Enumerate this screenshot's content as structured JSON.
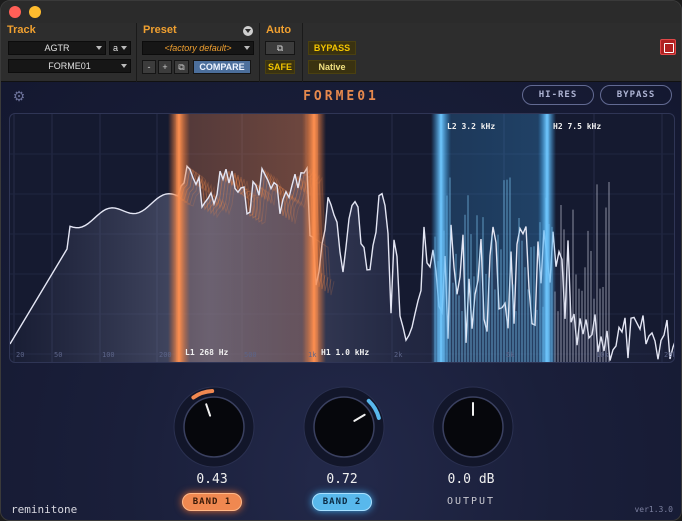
{
  "host": {
    "track_label": "Track",
    "track_name": "AGTR",
    "track_channel": "a",
    "plugin_insert": "FORME01",
    "preset_label": "Preset",
    "preset_name": "<factory default>",
    "minus": "-",
    "plus": "+",
    "compare": "COMPARE",
    "auto_label": "Auto",
    "safe": "SAFE",
    "bypass": "BYPASS",
    "native": "Native"
  },
  "plugin": {
    "title": "FORME01",
    "hires": "HI-RES",
    "bypass": "BYPASS",
    "brand": "reminitone",
    "version": "ver1.3.0",
    "accent_orange": "#f08850",
    "accent_blue": "#58b8ec"
  },
  "spectrum": {
    "freq_ticks": [
      "20",
      "50",
      "100",
      "200",
      "500",
      "1k",
      "2k",
      "5k",
      "10k",
      "20k"
    ],
    "markers": {
      "L1": "L1 268 Hz",
      "H1": "H1 1.0 kHz",
      "L2": "L2 3.2 kHz",
      "H2": "H2 7.5 kHz"
    }
  },
  "knobs": {
    "band1": {
      "value": "0.43",
      "label": "BAND 1",
      "level": 0.43
    },
    "band2": {
      "value": "0.72",
      "label": "BAND 2",
      "level": 0.72
    },
    "output": {
      "value": "0.0 dB",
      "label": "OUTPUT",
      "level": 0.5
    }
  }
}
